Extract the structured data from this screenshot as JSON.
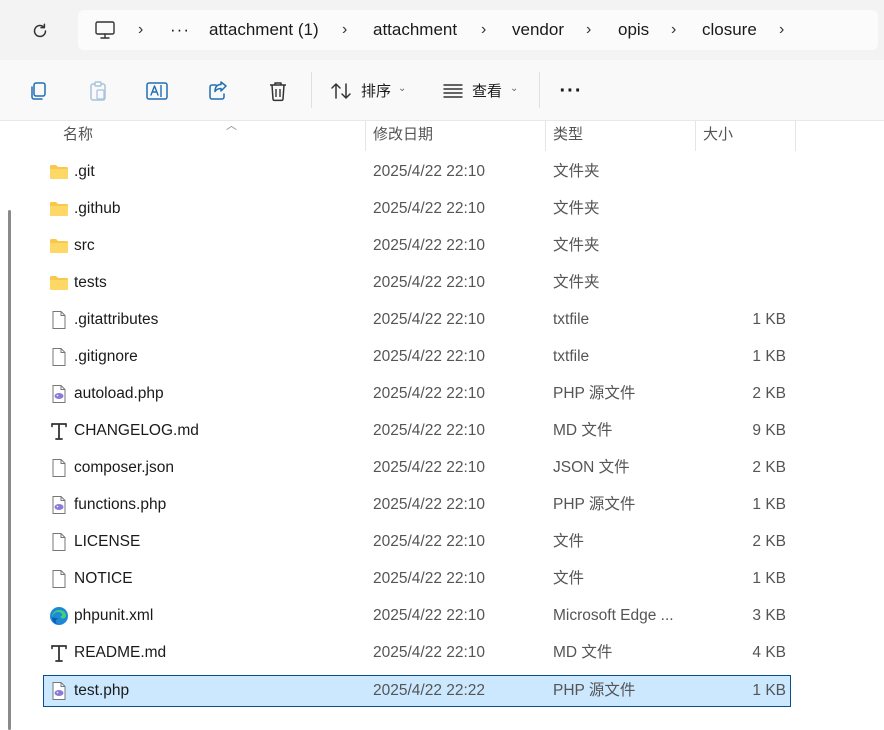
{
  "address_bar": {
    "more_glyph": "···",
    "breadcrumbs": [
      "attachment (1)",
      "attachment",
      "vendor",
      "opis",
      "closure"
    ]
  },
  "toolbar": {
    "sort_label": "排序",
    "view_label": "查看",
    "more_glyph": "···"
  },
  "columns": {
    "name": "名称",
    "date": "修改日期",
    "type": "类型",
    "size": "大小"
  },
  "files": [
    {
      "name": ".git",
      "date": "2025/4/22 22:10",
      "type": "文件夹",
      "size": "",
      "icon": "folder-icon"
    },
    {
      "name": ".github",
      "date": "2025/4/22 22:10",
      "type": "文件夹",
      "size": "",
      "icon": "folder-icon"
    },
    {
      "name": "src",
      "date": "2025/4/22 22:10",
      "type": "文件夹",
      "size": "",
      "icon": "folder-icon"
    },
    {
      "name": "tests",
      "date": "2025/4/22 22:10",
      "type": "文件夹",
      "size": "",
      "icon": "folder-icon"
    },
    {
      "name": ".gitattributes",
      "date": "2025/4/22 22:10",
      "type": "txtfile",
      "size": "1 KB",
      "icon": "blank-file-icon"
    },
    {
      "name": ".gitignore",
      "date": "2025/4/22 22:10",
      "type": "txtfile",
      "size": "1 KB",
      "icon": "blank-file-icon"
    },
    {
      "name": "autoload.php",
      "date": "2025/4/22 22:10",
      "type": "PHP 源文件",
      "size": "2 KB",
      "icon": "php-file-icon"
    },
    {
      "name": "CHANGELOG.md",
      "date": "2025/4/22 22:10",
      "type": "MD 文件",
      "size": "9 KB",
      "icon": "markdown-file-icon"
    },
    {
      "name": "composer.json",
      "date": "2025/4/22 22:10",
      "type": "JSON 文件",
      "size": "2 KB",
      "icon": "blank-file-icon"
    },
    {
      "name": "functions.php",
      "date": "2025/4/22 22:10",
      "type": "PHP 源文件",
      "size": "1 KB",
      "icon": "php-file-icon"
    },
    {
      "name": "LICENSE",
      "date": "2025/4/22 22:10",
      "type": "文件",
      "size": "2 KB",
      "icon": "blank-file-icon"
    },
    {
      "name": "NOTICE",
      "date": "2025/4/22 22:10",
      "type": "文件",
      "size": "1 KB",
      "icon": "blank-file-icon"
    },
    {
      "name": "phpunit.xml",
      "date": "2025/4/22 22:10",
      "type": "Microsoft Edge ...",
      "size": "3 KB",
      "icon": "edge-file-icon"
    },
    {
      "name": "README.md",
      "date": "2025/4/22 22:10",
      "type": "MD 文件",
      "size": "4 KB",
      "icon": "markdown-file-icon"
    },
    {
      "name": "test.php",
      "date": "2025/4/22 22:22",
      "type": "PHP 源文件",
      "size": "1 KB",
      "icon": "php-file-icon",
      "selected": true
    }
  ],
  "colors": {
    "selection_bg": "#cce8ff",
    "selection_border": "#0a4f8a",
    "folder": "#f8c84a",
    "accent": "#1f6fb5"
  }
}
